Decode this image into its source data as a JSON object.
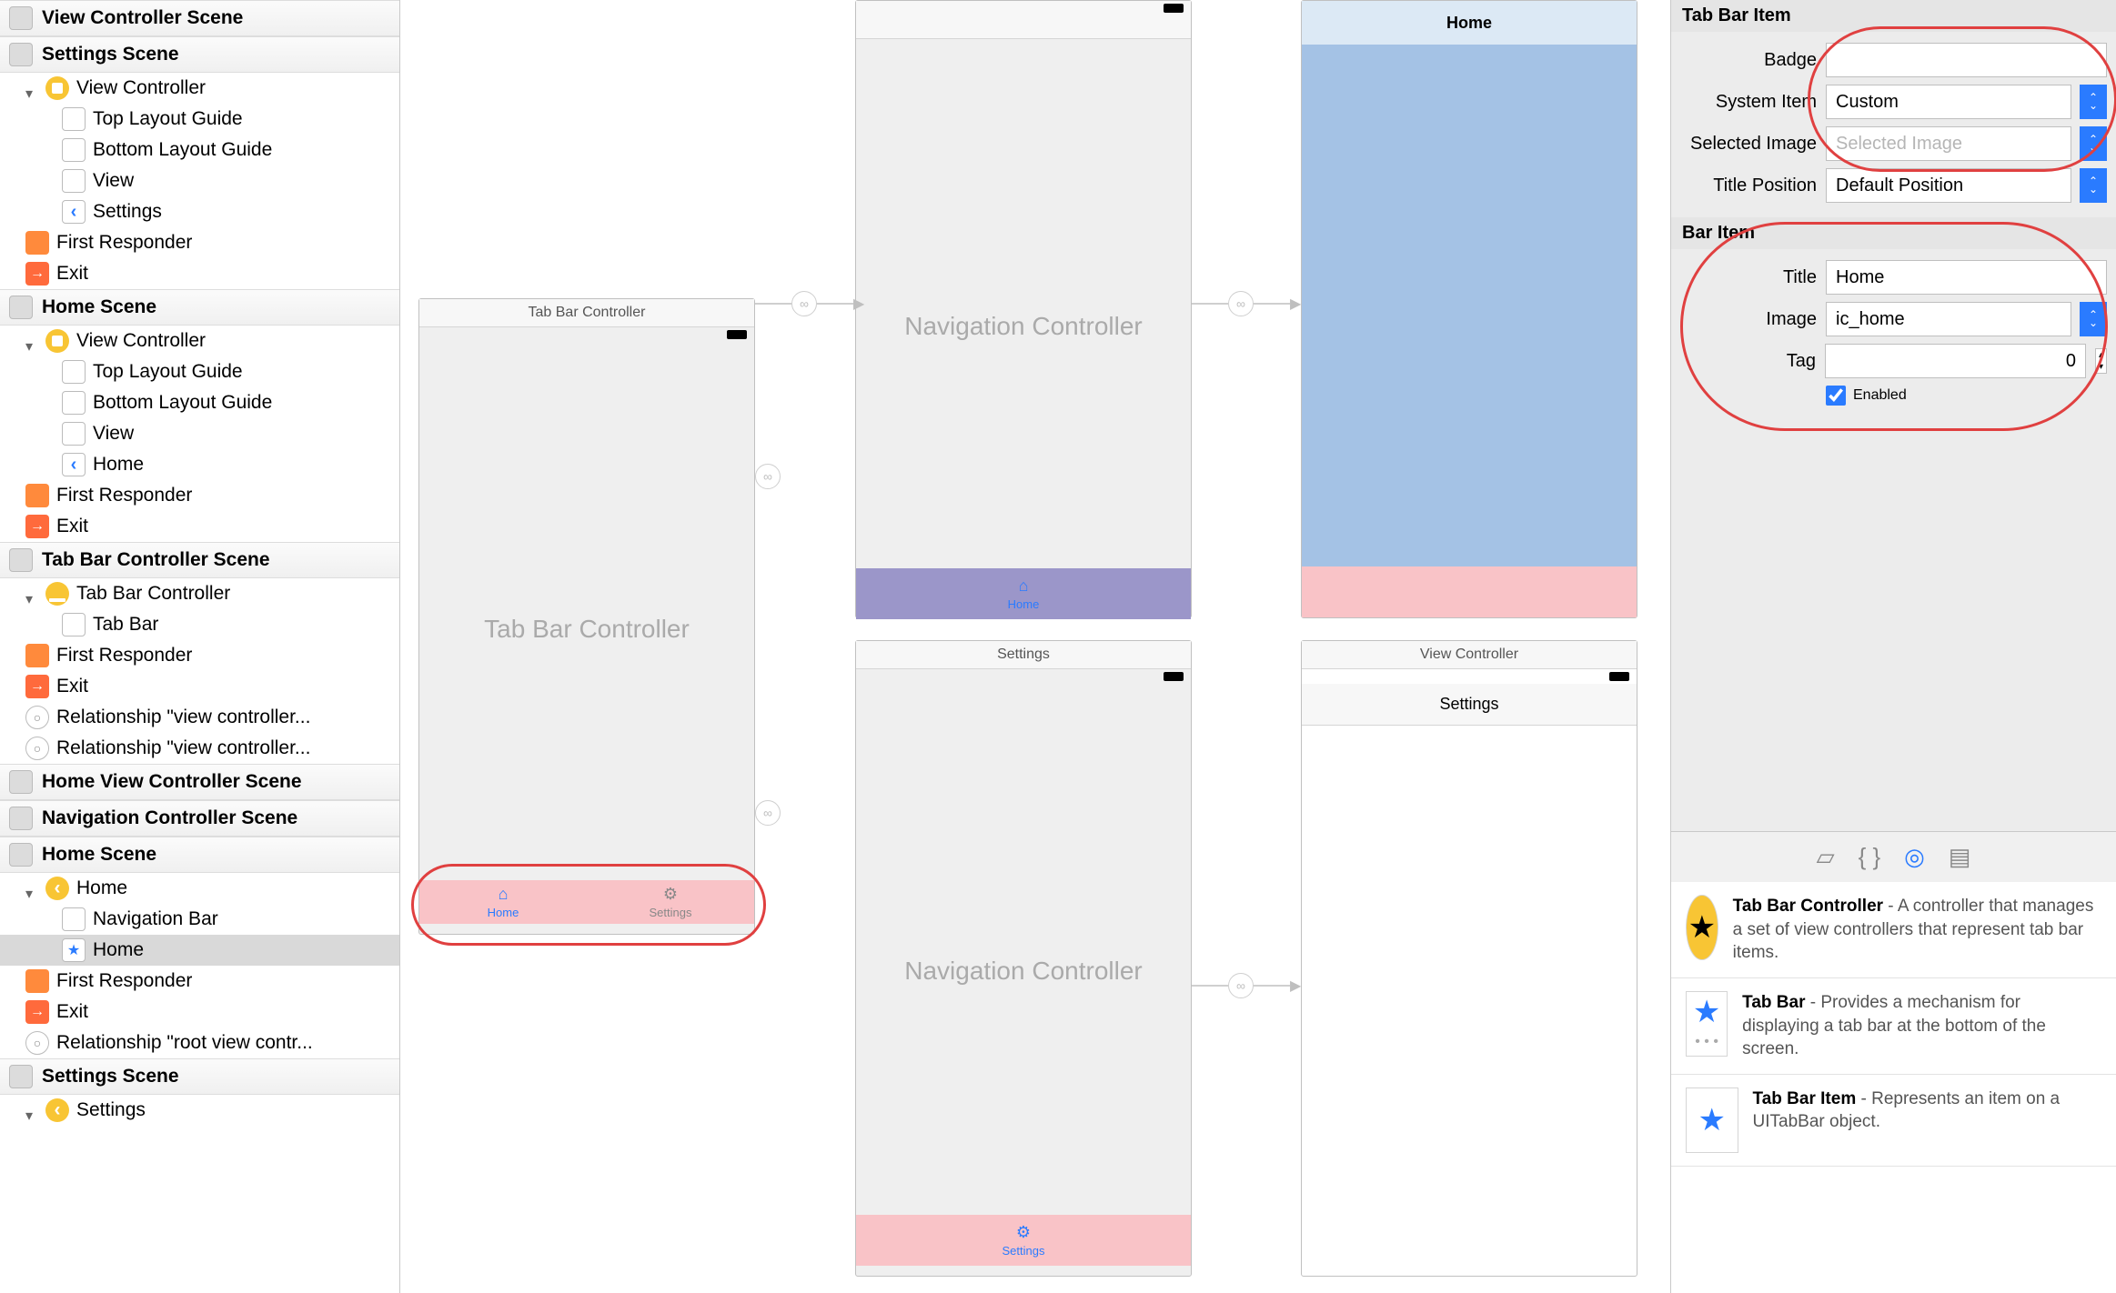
{
  "outline": {
    "scenes": [
      {
        "title": "View Controller Scene",
        "expanded": false
      },
      {
        "title": "Settings Scene",
        "vc": "View Controller",
        "items": [
          "Top Layout Guide",
          "Bottom Layout Guide",
          "View",
          "Settings"
        ],
        "first_responder": "First Responder",
        "exit": "Exit"
      },
      {
        "title": "Home Scene",
        "vc": "View Controller",
        "items": [
          "Top Layout Guide",
          "Bottom Layout Guide",
          "View",
          "Home"
        ],
        "first_responder": "First Responder",
        "exit": "Exit"
      },
      {
        "title": "Tab Bar Controller Scene",
        "vc": "Tab Bar Controller",
        "items_single": "Tab Bar",
        "first_responder": "First Responder",
        "exit": "Exit",
        "rel1": "Relationship \"view controller...",
        "rel2": "Relationship \"view controller..."
      },
      {
        "title": "Home View Controller Scene",
        "expanded": false
      },
      {
        "title": "Navigation Controller Scene",
        "expanded": false
      },
      {
        "title": "Home Scene",
        "nav_root": "Home",
        "items": [
          "Navigation Bar",
          "Home"
        ],
        "first_responder": "First Responder",
        "exit": "Exit",
        "rel1": "Relationship \"root view contr..."
      },
      {
        "title": "Settings Scene",
        "nav_root": "Settings"
      }
    ]
  },
  "canvas": {
    "tab_bar_controller": {
      "title": "Tab Bar Controller",
      "center_text": "Tab Bar Controller",
      "tabs": [
        {
          "label": "Home",
          "active": true,
          "glyph": "⌂"
        },
        {
          "label": "Settings",
          "active": false,
          "glyph": "⚙"
        }
      ]
    },
    "nav1": {
      "center_text": "Navigation Controller",
      "bottom_tab": "Home",
      "glyph": "⌂"
    },
    "nav2": {
      "title": "Settings",
      "center_text": "Navigation Controller",
      "bottom_tab": "Settings",
      "glyph": "⚙"
    },
    "home_vc": {
      "navbar_title": "Home"
    },
    "settings_vc": {
      "title": "View Controller",
      "navbar_title": "Settings"
    }
  },
  "inspector": {
    "tab_bar_item": {
      "section": "Tab Bar Item",
      "badge_label": "Badge",
      "badge_value": "",
      "system_item_label": "System Item",
      "system_item_value": "Custom",
      "selected_image_label": "Selected Image",
      "selected_image_placeholder": "Selected Image",
      "title_position_label": "Title Position",
      "title_position_value": "Default Position"
    },
    "bar_item": {
      "section": "Bar Item",
      "title_label": "Title",
      "title_value": "Home",
      "image_label": "Image",
      "image_value": "ic_home",
      "tag_label": "Tag",
      "tag_value": "0",
      "enabled_label": "Enabled",
      "enabled": true
    },
    "library": [
      {
        "title": "Tab Bar Controller",
        "desc": " - A controller that manages a set of view controllers that represent tab bar items."
      },
      {
        "title": "Tab Bar",
        "desc": " - Provides a mechanism for displaying a tab bar at the bottom of the screen."
      },
      {
        "title": "Tab Bar Item",
        "desc": " - Represents an item on a UITabBar object."
      }
    ]
  }
}
